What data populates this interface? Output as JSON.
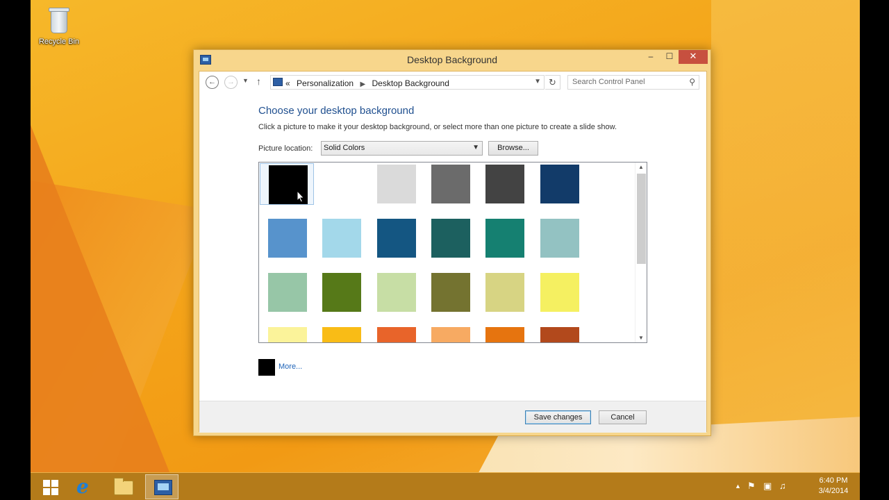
{
  "desktop": {
    "icons": [
      {
        "label": "Recycle Bin",
        "icon": "recycle-bin-icon"
      }
    ]
  },
  "window": {
    "title": "Desktop Background",
    "controls": {
      "minimize": "–",
      "maximize": "☐",
      "close": "✕"
    }
  },
  "navbar": {
    "back": "←",
    "forward": "→",
    "recent": "▼",
    "up": "↑",
    "breadcrumb_prefix": "«",
    "breadcrumb": [
      "Personalization",
      "Desktop Background"
    ],
    "refresh": "↻",
    "search_placeholder": "Search Control Panel"
  },
  "content": {
    "heading": "Choose your desktop background",
    "description": "Click a picture to make it your desktop background, or select more than one picture to create a slide show.",
    "location_label": "Picture location:",
    "location_value": "Solid Colors",
    "browse_label": "Browse...",
    "more_label": "More..."
  },
  "gallery": {
    "selected_index": 0,
    "colors": [
      "#000000",
      "#ffffff",
      "#dadada",
      "#6b6b6b",
      "#434343",
      "#123b69",
      "#5793cc",
      "#a3d8ea",
      "#145682",
      "#1c605f",
      "#158071",
      "#93c2c2",
      "#97c6a7",
      "#567918",
      "#c7dea5",
      "#747330",
      "#d7d483",
      "#f5f061",
      "#fbf39a",
      "#f9bc16",
      "#e8642a",
      "#f7aa62",
      "#e6740f",
      "#b2491c"
    ]
  },
  "footer": {
    "save_label": "Save changes",
    "cancel_label": "Cancel"
  },
  "taskbar": {
    "pinned": [
      "start-button",
      "internet-explorer",
      "file-explorer",
      "control-panel"
    ],
    "active": "control-panel",
    "time": "6:40 PM",
    "date": "3/4/2014"
  }
}
